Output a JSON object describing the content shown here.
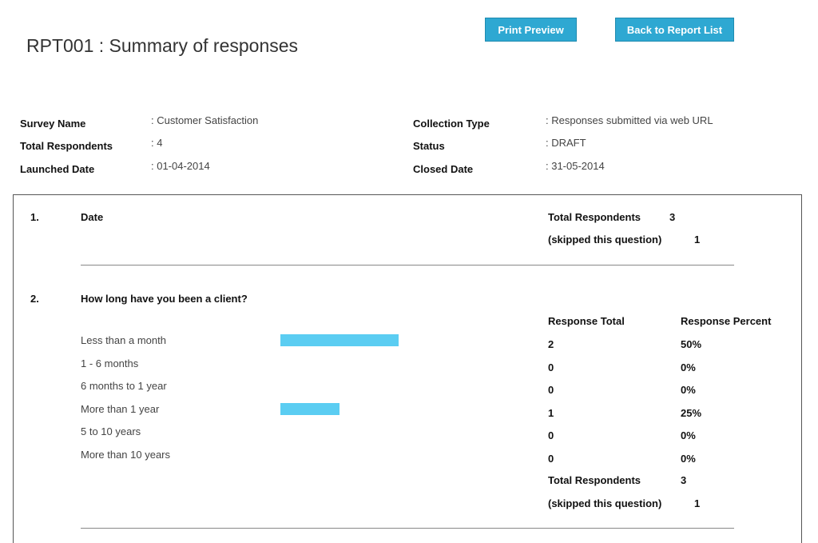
{
  "header": {
    "title": "RPT001 : Summary of responses",
    "print_preview_label": "Print Preview",
    "back_label": "Back to Report List"
  },
  "meta": {
    "left": [
      {
        "label": "Survey Name",
        "value": ": Customer Satisfaction"
      },
      {
        "label": "Total Respondents",
        "value": ": 4"
      },
      {
        "label": "Launched Date",
        "value": ": 01-04-2014"
      }
    ],
    "right": [
      {
        "label": "Collection Type",
        "value": ": Responses submitted via web URL"
      },
      {
        "label": "Status",
        "value": ": DRAFT"
      },
      {
        "label": "Closed Date",
        "value": ": 31-05-2014"
      }
    ]
  },
  "questions": [
    {
      "number": "1.",
      "title": "Date",
      "total_label": "Total Respondents",
      "total_value": "3",
      "skipped_label": "(skipped this question)",
      "skipped_value": "1"
    },
    {
      "number": "2.",
      "title": "How long have you been a client?",
      "col_total_header": "Response Total",
      "col_percent_header": "Response Percent",
      "bar_color": "#5bcdf2",
      "options": [
        {
          "label": "Less than a month",
          "total": "2",
          "percent": "50%",
          "fraction": 0.5
        },
        {
          "label": "1 - 6 months",
          "total": "0",
          "percent": "0%",
          "fraction": 0
        },
        {
          "label": "6 months to 1 year",
          "total": "0",
          "percent": "0%",
          "fraction": 0
        },
        {
          "label": "More than 1 year",
          "total": "1",
          "percent": "25%",
          "fraction": 0.25
        },
        {
          "label": "5 to 10 years",
          "total": "0",
          "percent": "0%",
          "fraction": 0
        },
        {
          "label": "More than 10 years",
          "total": "0",
          "percent": "0%",
          "fraction": 0
        }
      ],
      "total_label": "Total Respondents",
      "total_value": "3",
      "skipped_label": "(skipped this question)",
      "skipped_value": "1"
    }
  ]
}
